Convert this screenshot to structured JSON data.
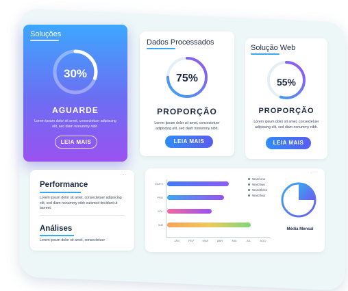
{
  "card_solucoes": {
    "title": "Soluções",
    "percent": "30%",
    "progress": 0.3,
    "heading": "AGUARDE",
    "body": "Lorem ipsum dolor sit amet, consectetuer adipiscing elit, sed diam nonummy nibh.",
    "button": "LEIA MAIS"
  },
  "card_dados": {
    "title": "Dados Processados",
    "percent": "75%",
    "progress": 0.75,
    "heading": "PROPORÇÃO",
    "body": "Lorem ipsum dolor sit amet, consectetuer adipiscing elit, sed diam nonummy nibh.",
    "button": "LEIA MAIS"
  },
  "card_web": {
    "title": "Solução Web",
    "percent": "55%",
    "progress": 0.55,
    "heading": "PROPORÇÃO",
    "body": "Lorem ipsum dolor sit amet, consectetuer adipiscing elit, sed diam nonummy nibh.",
    "button": "LEIA MAIS"
  },
  "performance": {
    "title": "Performance",
    "body": "Lorem ipsum dolor sit amet, consectetuer adipiscing elit, sed diam nonummy nibh euismod tincidunt ut laoreet.",
    "title2": "Análises",
    "body2": "Lorem ipsum dolor sit amet, consectetuer"
  },
  "chart_panel": {
    "dots": "···",
    "legend": [
      "Word one",
      "Word two",
      "Word three",
      "Word four"
    ],
    "pie_label": "Média Mensal"
  },
  "chart_data": {
    "type": "bar",
    "orientation": "horizontal",
    "categories": [
      "DAR'S",
      "PRO",
      "SOL",
      "SIM"
    ],
    "values": [
      0.6,
      0.55,
      0.43,
      0.81
    ],
    "x_ticks": [
      "JAN",
      "FEV",
      "MAR",
      "ABR",
      "MAI",
      "JUL",
      "AGO"
    ],
    "legend": [
      "Word one",
      "Word two",
      "Word three",
      "Word four"
    ],
    "pie": {
      "label": "Média Mensal",
      "fraction": 0.25
    }
  },
  "colors": {
    "accent": "#3aa8f0",
    "purple": "#8b55ef",
    "dark": "#1c2a44"
  }
}
